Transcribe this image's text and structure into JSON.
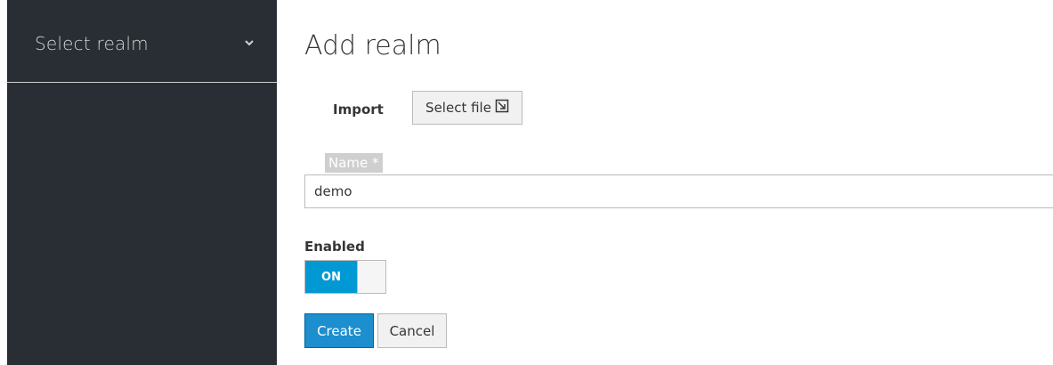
{
  "sidebar": {
    "realm_selector": {
      "label": "Select realm",
      "icon": "chevron-down-icon"
    }
  },
  "main": {
    "title": "Add realm",
    "import": {
      "label": "Import",
      "button_label": "Select file",
      "button_icon": "import-file-icon"
    },
    "name": {
      "label": "Name *",
      "value": "demo"
    },
    "enabled": {
      "label": "Enabled",
      "switch_text": "ON",
      "state": true
    },
    "actions": {
      "create_label": "Create",
      "cancel_label": "Cancel"
    }
  },
  "colors": {
    "sidebar_bg": "#292e34",
    "primary": "#0099d3",
    "create_button": "#1d8ece"
  }
}
